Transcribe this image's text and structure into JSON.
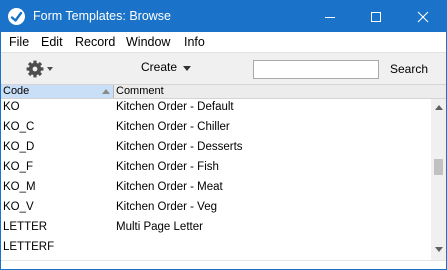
{
  "window": {
    "title": "Form Templates: Browse"
  },
  "menu": {
    "items": [
      "File",
      "Edit",
      "Record",
      "Window",
      "Info"
    ]
  },
  "toolbar": {
    "create_label": "Create",
    "search_placeholder": "",
    "search_value": "",
    "search_label": "Search"
  },
  "table": {
    "columns": [
      "Code",
      "Comment"
    ],
    "sort": {
      "column": "Code",
      "direction": "ascending"
    },
    "rows": [
      {
        "code": "KO",
        "comment": "Kitchen Order - Default"
      },
      {
        "code": "KO_C",
        "comment": "Kitchen Order - Chiller"
      },
      {
        "code": "KO_D",
        "comment": "Kitchen Order - Desserts"
      },
      {
        "code": "KO_F",
        "comment": "Kitchen Order - Fish"
      },
      {
        "code": "KO_M",
        "comment": "Kitchen Order - Meat"
      },
      {
        "code": "KO_V",
        "comment": "Kitchen Order - Veg"
      },
      {
        "code": "LETTER",
        "comment": "Multi Page Letter"
      },
      {
        "code": "LETTERF",
        "comment": ""
      }
    ]
  },
  "colors": {
    "titlebar": "#1a73c8",
    "header_selected": "#c9dff7",
    "toolbar_bg": "#f0f0f0"
  },
  "icons": {
    "app": "app-icon",
    "gear": "gear-icon",
    "minimize": "minimize-icon",
    "maximize": "maximize-icon",
    "close": "close-icon"
  }
}
